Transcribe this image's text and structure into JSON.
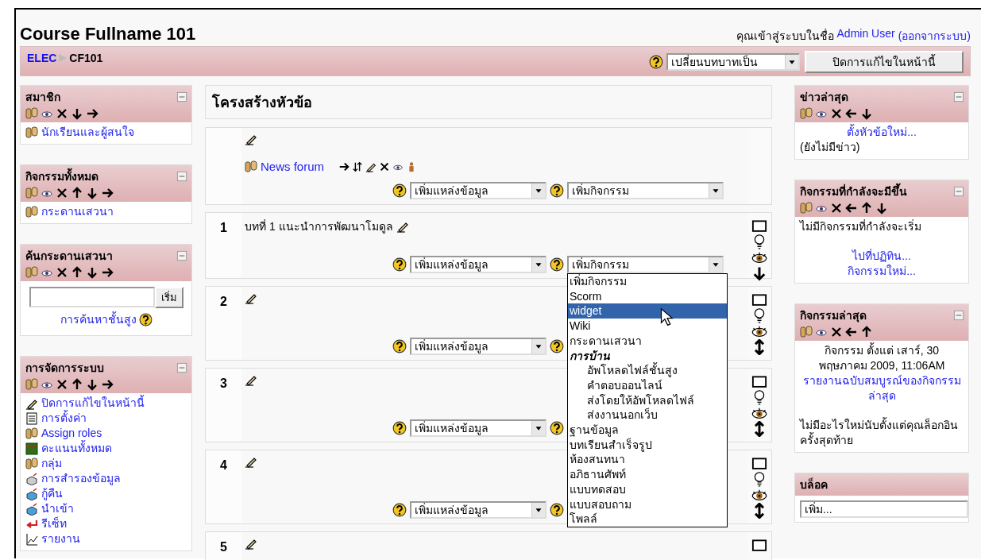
{
  "header": {
    "title": "Course Fullname 101",
    "login_text": "คุณเข้าสู่ระบบในชื่อ",
    "user_link": "Admin User",
    "logout_link": "(ออกจากระบบ)"
  },
  "navbar": {
    "breadcrumb": [
      {
        "label": "ELEC",
        "link": true
      },
      {
        "label": "CF101",
        "link": false
      }
    ],
    "role_select": "เปลี่ยนบทบาทเป็น",
    "edit_button": "ปิดการแก้ไขในหน้านี้"
  },
  "left_blocks": [
    {
      "kind": "links",
      "title": "สมาชิก",
      "controls": [
        {
          "kind": "roles"
        },
        {
          "kind": "hide"
        },
        {
          "kind": "delete"
        },
        {
          "kind": "down"
        },
        {
          "kind": "right"
        }
      ],
      "items": [
        {
          "kind": "forum",
          "label": "นักเรียนและผู้สนใจ"
        }
      ]
    },
    {
      "kind": "links",
      "title": "กิจกรรมทั้งหมด",
      "controls": [
        {
          "kind": "roles"
        },
        {
          "kind": "hide"
        },
        {
          "kind": "delete"
        },
        {
          "kind": "up"
        },
        {
          "kind": "down"
        },
        {
          "kind": "right"
        }
      ],
      "items": [
        {
          "kind": "forum",
          "label": "กระดานเสวนา"
        }
      ]
    },
    {
      "kind": "search",
      "title": "ค้นกระดานเสวนา",
      "controls": [
        {
          "kind": "roles"
        },
        {
          "kind": "hide"
        },
        {
          "kind": "delete"
        },
        {
          "kind": "up"
        },
        {
          "kind": "down"
        },
        {
          "kind": "right"
        }
      ],
      "button": "เริ่ม",
      "advanced_link": "การค้นหาชั้นสูง"
    },
    {
      "kind": "links",
      "title": "การจัดการระบบ",
      "controls": [
        {
          "kind": "roles"
        },
        {
          "kind": "hide"
        },
        {
          "kind": "delete"
        },
        {
          "kind": "up"
        },
        {
          "kind": "down"
        },
        {
          "kind": "right"
        }
      ],
      "items": [
        {
          "kind": "edit",
          "label": "ปิดการแก้ไขในหน้านี้"
        },
        {
          "kind": "settings",
          "label": "การตั้งค่า"
        },
        {
          "kind": "roles",
          "label": "Assign roles"
        },
        {
          "kind": "grades",
          "label": "คะแนนทั้งหมด"
        },
        {
          "kind": "groups",
          "label": "กลุ่ม"
        },
        {
          "kind": "backup",
          "label": "การสำรองข้อมูล"
        },
        {
          "kind": "restore",
          "label": "กู้คืน"
        },
        {
          "kind": "restore",
          "label": "นำเข้า"
        },
        {
          "kind": "reset",
          "label": "รีเซ็ท"
        },
        {
          "kind": "report",
          "label": "รายงาน"
        }
      ]
    }
  ],
  "main": {
    "title": "โครงสร้างหัวข้อ",
    "sections": [
      {
        "activities": [
          {
            "label": "News forum",
            "controls": [
              {
                "kind": "right"
              },
              {
                "kind": "move"
              },
              {
                "kind": "edit"
              },
              {
                "kind": "delete"
              },
              {
                "kind": "hide"
              },
              {
                "kind": "person"
              }
            ]
          }
        ],
        "selects": [
          {
            "kind": "resource",
            "label": "เพิ่มแหล่งข้อมูล"
          },
          {
            "kind": "activity",
            "label": "เพิ่มกิจกรรม",
            "open": false
          }
        ]
      },
      {
        "number": "1",
        "title": "บทที่ 1 แนะนำการพัฒนาโมดูล",
        "selects": [
          {
            "kind": "resource",
            "label": "เพิ่มแหล่งข้อมูล"
          },
          {
            "kind": "activity",
            "label": "เพิ่มกิจกรรม",
            "open": true
          }
        ],
        "side_controls": [
          {
            "kind": "highlight"
          },
          {
            "kind": "bulb"
          },
          {
            "kind": "eye"
          },
          {
            "kind": "down"
          }
        ]
      },
      {
        "number": "2",
        "selects": [
          {
            "kind": "resource",
            "label": "เพิ่มแหล่งข้อมูล"
          },
          {
            "kind": "covered"
          }
        ],
        "side_controls": [
          {
            "kind": "highlight"
          },
          {
            "kind": "bulb"
          },
          {
            "kind": "eye"
          },
          {
            "kind": "updown"
          }
        ]
      },
      {
        "number": "3",
        "selects": [
          {
            "kind": "resource",
            "label": "เพิ่มแหล่งข้อมูล"
          },
          {
            "kind": "covered"
          }
        ],
        "side_controls": [
          {
            "kind": "highlight"
          },
          {
            "kind": "bulb"
          },
          {
            "kind": "eye"
          },
          {
            "kind": "updown"
          }
        ]
      },
      {
        "number": "4",
        "selects": [
          {
            "kind": "resource",
            "label": "เพิ่มแหล่งข้อมูล"
          },
          {
            "kind": "covered"
          }
        ],
        "side_controls": [
          {
            "kind": "highlight"
          },
          {
            "kind": "bulb"
          },
          {
            "kind": "eye"
          },
          {
            "kind": "updown"
          }
        ]
      },
      {
        "number": "5",
        "side_controls": [
          {
            "kind": "highlight"
          }
        ]
      }
    ]
  },
  "dropdown": {
    "options": [
      {
        "label": "เพิ่มกิจกรรม",
        "selected": false
      },
      {
        "label": "Scorm",
        "selected": false
      },
      {
        "label": "widget",
        "selected": true
      },
      {
        "label": "Wiki",
        "selected": false
      },
      {
        "label": "กระดานเสวนา",
        "selected": false
      },
      {
        "label": "การบ้าน",
        "kind": "group",
        "selected": false,
        "children": [
          {
            "label": "อัพโหลดไฟล์ชั้นสูง",
            "selected": false
          },
          {
            "label": "คำตอบออนไลน์",
            "selected": false
          },
          {
            "label": "ส่งโดยให้อัพโหลดไฟล์",
            "selected": false
          },
          {
            "label": "ส่งงานนอกเว็บ",
            "selected": false
          }
        ]
      },
      {
        "label": "ฐานข้อมูล",
        "selected": false
      },
      {
        "label": "บทเรียนสำเร็จรูป",
        "selected": false
      },
      {
        "label": "ห้องสนทนา",
        "selected": false
      },
      {
        "label": "อภิธานศัพท์",
        "selected": false
      },
      {
        "label": "แบบทดสอบ",
        "selected": false
      },
      {
        "label": "แบบสอบถาม",
        "selected": false
      },
      {
        "label": "โพลล์",
        "selected": false
      }
    ]
  },
  "right_blocks": [
    {
      "title": "ข่าวล่าสุด",
      "controls": [
        {
          "kind": "roles"
        },
        {
          "kind": "hide"
        },
        {
          "kind": "delete"
        },
        {
          "kind": "left"
        },
        {
          "kind": "down"
        }
      ],
      "content": [
        {
          "kind": "link",
          "text": "ตั้งหัวข้อใหม่..."
        },
        {
          "kind": "text",
          "text": "(ยังไม่มีข่าว)"
        }
      ]
    },
    {
      "title": "กิจกรรมที่กำลังจะมีขึ้น",
      "controls": [
        {
          "kind": "roles"
        },
        {
          "kind": "hide"
        },
        {
          "kind": "delete"
        },
        {
          "kind": "left"
        },
        {
          "kind": "up"
        },
        {
          "kind": "down"
        }
      ],
      "content": [
        {
          "kind": "text",
          "text": "ไม่มีกิจกรรมที่กำลังจะเริ่ม"
        },
        {
          "kind": "gap"
        },
        {
          "kind": "link",
          "text": "ไปที่ปฏิทิน..."
        },
        {
          "kind": "link",
          "text": "กิจกรรมใหม่..."
        }
      ]
    },
    {
      "title": "กิจกรรมล่าสุด",
      "controls": [
        {
          "kind": "roles"
        },
        {
          "kind": "hide"
        },
        {
          "kind": "delete"
        },
        {
          "kind": "left"
        },
        {
          "kind": "up"
        }
      ],
      "content": [
        {
          "kind": "caption",
          "text": "กิจกรรม ตั้งแต่ เสาร์, 30 พฤษภาคม 2009, 11:06AM"
        },
        {
          "kind": "link",
          "text": "รายงานฉบับสมบูรณ์ของกิจกรรมล่าสุด"
        },
        {
          "kind": "gap"
        },
        {
          "kind": "text",
          "text": "ไม่มีอะไรใหม่นับตั้งแต่คุณล็อกอินครั้งสุดท้าย"
        }
      ]
    },
    {
      "title": "บล็อค",
      "select": "เพิ่ม..."
    }
  ]
}
